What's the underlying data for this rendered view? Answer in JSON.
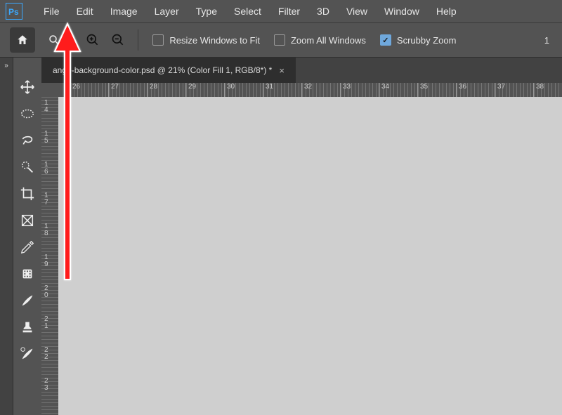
{
  "menu": {
    "items": [
      "File",
      "Edit",
      "Image",
      "Layer",
      "Type",
      "Select",
      "Filter",
      "3D",
      "View",
      "Window",
      "Help"
    ]
  },
  "optionbar": {
    "resize_label": "Resize Windows to Fit",
    "resize_checked": false,
    "zoom_all_label": "Zoom All Windows",
    "zoom_all_checked": false,
    "scrubby_label": "Scrubby Zoom",
    "scrubby_checked": true,
    "trailing_value": "1"
  },
  "document": {
    "tab_label": "ange-background-color.psd @ 21% (Color Fill 1, RGB/8*) *"
  },
  "ruler": {
    "h_ticks": [
      "26",
      "27",
      "28",
      "29",
      "30",
      "31",
      "32",
      "33",
      "34",
      "35",
      "36",
      "37",
      "38"
    ],
    "v_ticks": [
      "14",
      "15",
      "16",
      "17",
      "18",
      "19",
      "20",
      "21",
      "22",
      "23"
    ]
  },
  "tools": [
    {
      "name": "move-tool"
    },
    {
      "name": "marquee-tool"
    },
    {
      "name": "lasso-tool"
    },
    {
      "name": "quick-select-tool"
    },
    {
      "name": "crop-tool"
    },
    {
      "name": "frame-tool"
    },
    {
      "name": "eyedropper-tool"
    },
    {
      "name": "healing-brush-tool"
    },
    {
      "name": "brush-tool"
    },
    {
      "name": "stamp-tool"
    },
    {
      "name": "history-brush-tool"
    }
  ]
}
